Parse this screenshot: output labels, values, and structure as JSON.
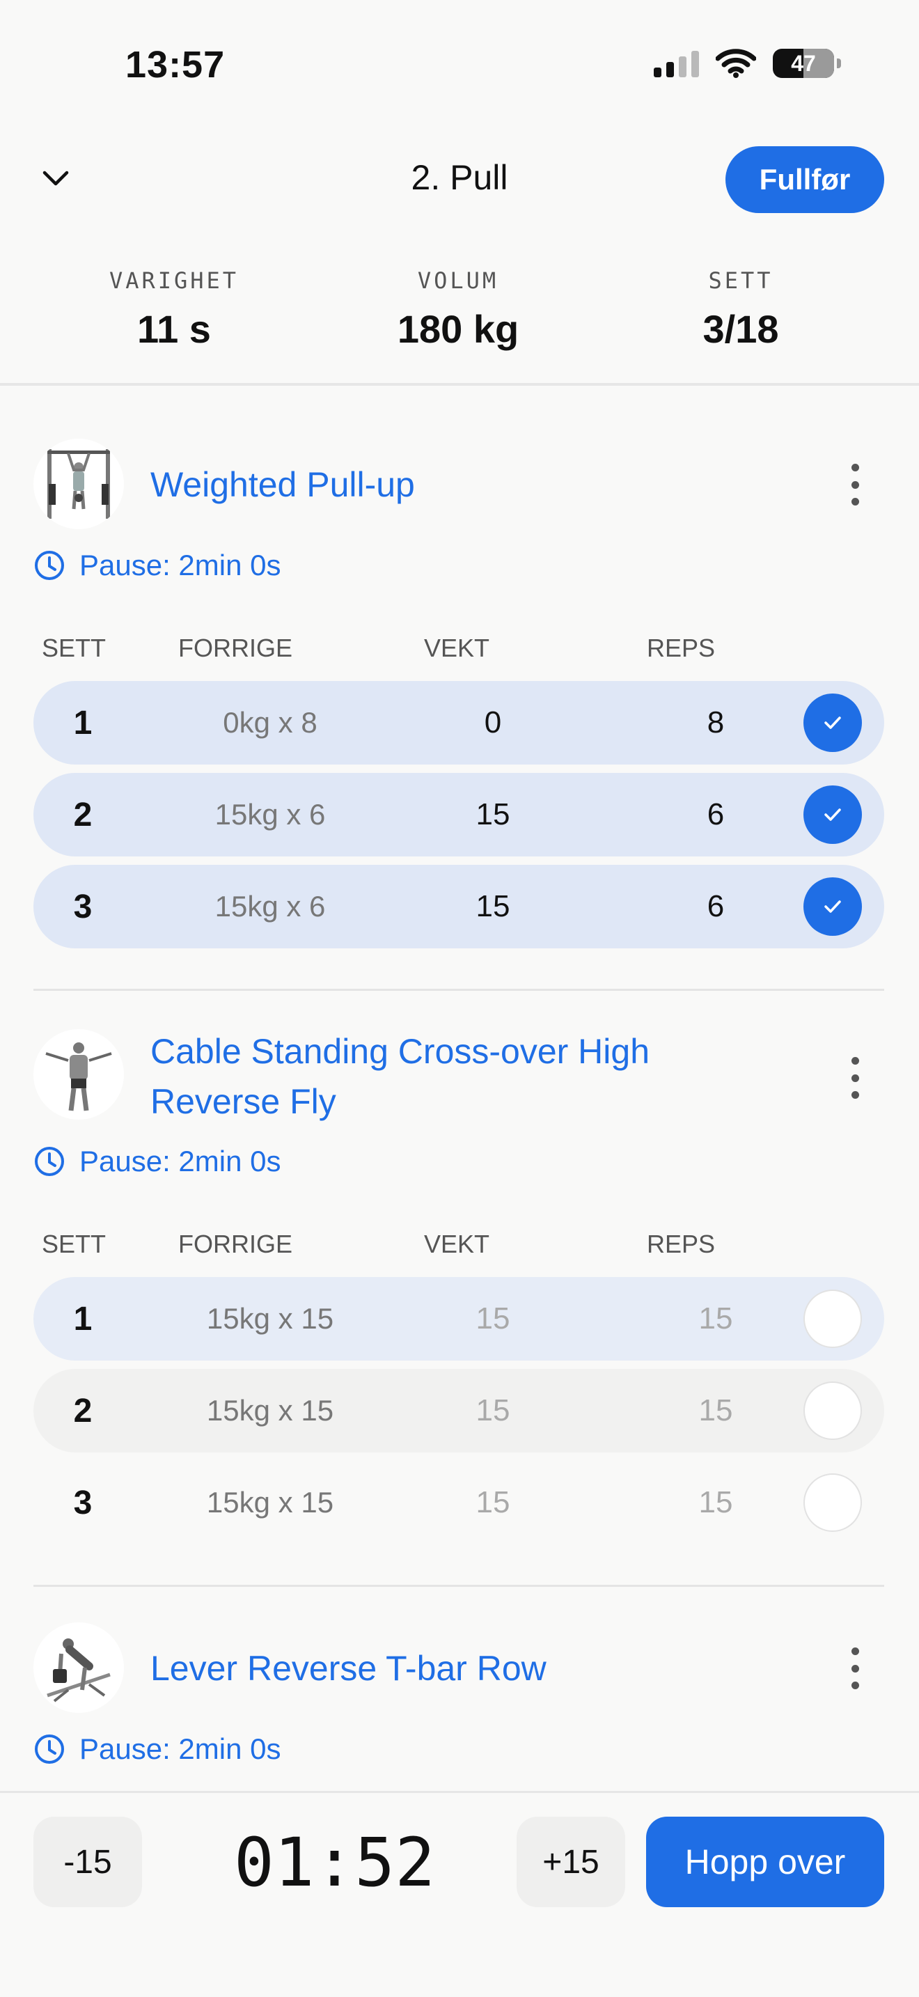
{
  "status_bar": {
    "time": "13:57",
    "battery": "47"
  },
  "header": {
    "title": "2. Pull",
    "finish_label": "Fullfør"
  },
  "stats": [
    {
      "label": "VARIGHET",
      "value": "11 s"
    },
    {
      "label": "VOLUM",
      "value": "180 kg"
    },
    {
      "label": "SETT",
      "value": "3/18"
    }
  ],
  "columns": {
    "set": "SETT",
    "previous": "FORRIGE",
    "weight": "VEKT",
    "reps": "REPS"
  },
  "exercises": [
    {
      "name": "Weighted Pull-up",
      "pause": "Pause: 2min 0s",
      "sets": [
        {
          "set": "1",
          "previous": "0kg x 8",
          "weight": "0",
          "reps": "8",
          "done": true
        },
        {
          "set": "2",
          "previous": "15kg x 6",
          "weight": "15",
          "reps": "6",
          "done": true
        },
        {
          "set": "3",
          "previous": "15kg x 6",
          "weight": "15",
          "reps": "6",
          "done": true
        }
      ]
    },
    {
      "name_line1": "Cable Standing Cross-over High",
      "name_line2": "Reverse Fly",
      "pause": "Pause: 2min 0s",
      "sets": [
        {
          "set": "1",
          "previous": "15kg x 15",
          "weight": "15",
          "reps": "15",
          "done": false
        },
        {
          "set": "2",
          "previous": "15kg x 15",
          "weight": "15",
          "reps": "15",
          "done": false
        },
        {
          "set": "3",
          "previous": "15kg x 15",
          "weight": "15",
          "reps": "15",
          "done": false
        }
      ]
    },
    {
      "name": "Lever Reverse T-bar Row",
      "pause": "Pause: 2min 0s"
    }
  ],
  "rest_timer": {
    "minus_label": "-15",
    "time": "01:52",
    "plus_label": "+15",
    "skip_label": "Hopp over"
  },
  "colors": {
    "accent": "#1f6ee5",
    "done_row": "#dfe7f6"
  }
}
